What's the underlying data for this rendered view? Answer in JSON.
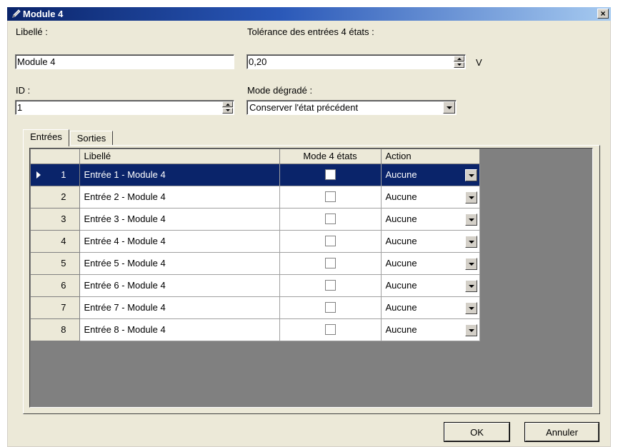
{
  "window": {
    "title": "Module 4",
    "close_label": "×"
  },
  "form": {
    "libelle_label": "Libellé :",
    "libelle_value": "Module 4",
    "tolerance_label": "Tolérance des entrées 4 états :",
    "tolerance_value": "0,20",
    "tolerance_unit": "V",
    "id_label": "ID :",
    "id_value": "1",
    "mode_label": "Mode dégradé :",
    "mode_value": "Conserver l'état précédent"
  },
  "tabs": [
    {
      "label": "Entrées",
      "active": true
    },
    {
      "label": "Sorties",
      "active": false
    }
  ],
  "grid": {
    "columns": [
      "",
      "Libellé",
      "Mode 4 états",
      "Action"
    ],
    "rows": [
      {
        "num": "1",
        "libelle": "Entrée 1 - Module 4",
        "mode4": false,
        "action": "Aucune",
        "selected": true
      },
      {
        "num": "2",
        "libelle": "Entrée 2 - Module 4",
        "mode4": false,
        "action": "Aucune",
        "selected": false
      },
      {
        "num": "3",
        "libelle": "Entrée 3 - Module 4",
        "mode4": false,
        "action": "Aucune",
        "selected": false
      },
      {
        "num": "4",
        "libelle": "Entrée 4 - Module 4",
        "mode4": false,
        "action": "Aucune",
        "selected": false
      },
      {
        "num": "5",
        "libelle": "Entrée 5 - Module 4",
        "mode4": false,
        "action": "Aucune",
        "selected": false
      },
      {
        "num": "6",
        "libelle": "Entrée 6 - Module 4",
        "mode4": false,
        "action": "Aucune",
        "selected": false
      },
      {
        "num": "7",
        "libelle": "Entrée 7 - Module 4",
        "mode4": false,
        "action": "Aucune",
        "selected": false
      },
      {
        "num": "8",
        "libelle": "Entrée 8 - Module 4",
        "mode4": false,
        "action": "Aucune",
        "selected": false
      }
    ]
  },
  "buttons": {
    "ok_label": "OK",
    "cancel_label": "Annuler"
  },
  "colors": {
    "title_start": "#0a246a",
    "title_end": "#a6caf0",
    "selection": "#0a246a",
    "dialog_bg": "#ece9d8",
    "grid_bg": "#808080"
  },
  "icons": {
    "title": "pen-icon",
    "close": "close-icon",
    "row_indicator": "triangle-right-icon",
    "dropdown": "chevron-down-icon"
  }
}
